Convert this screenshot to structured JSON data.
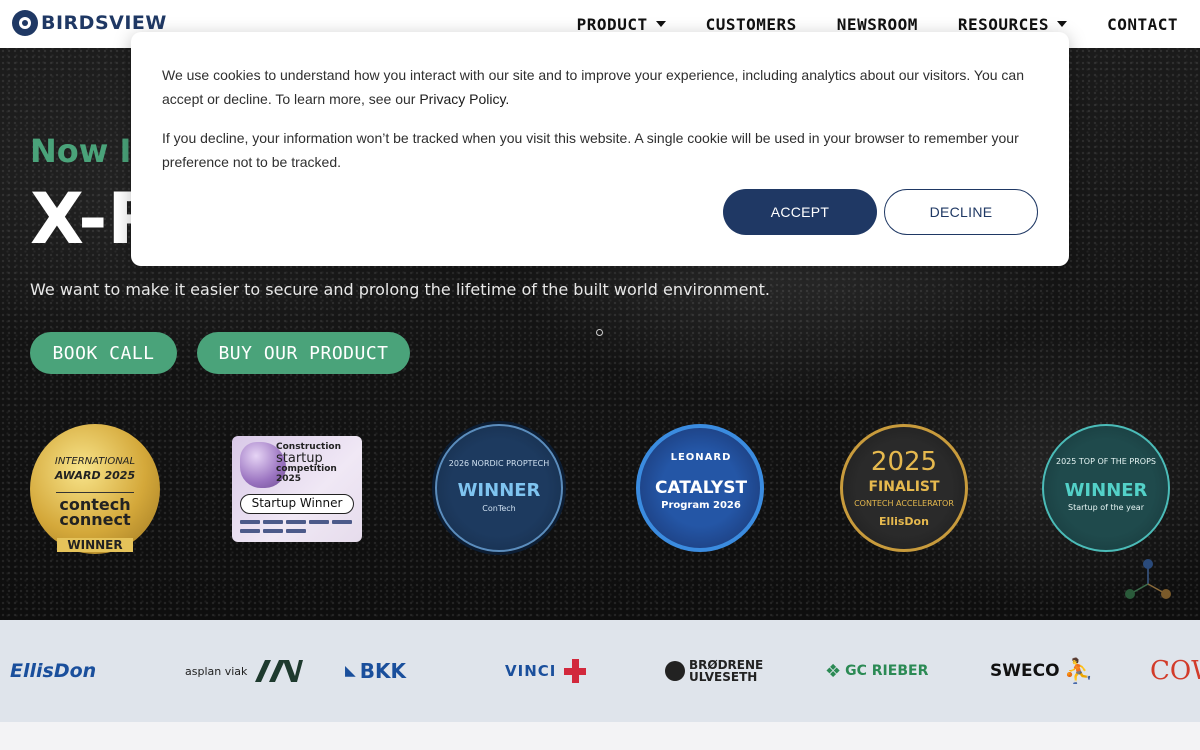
{
  "header": {
    "logo_text": "BIRDSVIEW",
    "nav": [
      {
        "label": "PRODUCT",
        "has_dropdown": true
      },
      {
        "label": "CUSTOMERS",
        "has_dropdown": false
      },
      {
        "label": "NEWSROOM",
        "has_dropdown": false
      },
      {
        "label": "RESOURCES",
        "has_dropdown": true
      },
      {
        "label": "CONTACT",
        "has_dropdown": false
      }
    ]
  },
  "hero": {
    "eyebrow": "Now In",
    "title": "X-R",
    "subtitle": "We want to make it easier to secure and prolong the lifetime of the built world environment.",
    "book_button": "BOOK CALL",
    "buy_button": "BUY OUR PRODUCT"
  },
  "badges": {
    "contech": {
      "line1": "INTERNATIONAL",
      "line2": "AWARD 2025",
      "brand": "contech connect",
      "ribbon": "WINNER"
    },
    "startup": {
      "line1": "Construction",
      "line2": "startup",
      "line3": "competition 2025",
      "pill": "Startup Winner"
    },
    "nordic": {
      "top": "2026 NORDIC PROPTECH",
      "main": "WINNER",
      "sub": "ConTech"
    },
    "leonard": {
      "brand": "LEONARD",
      "main": "CATALYST",
      "sub": "Program 2026"
    },
    "ellisdon": {
      "year": "2025",
      "main": "FINALIST",
      "sub": "CONTECH ACCELERATOR",
      "brand": "EllisDon"
    },
    "props": {
      "top": "2025 TOP OF THE PROPS",
      "main": "WINNER",
      "sub": "Startup of the year"
    }
  },
  "clients": [
    "EllisDon",
    "asplan viak",
    "BKK",
    "VINCI",
    "BRØDRENE ULVESETH",
    "GC RIEBER",
    "SWECO",
    "COW"
  ],
  "cookie": {
    "text1": "We use cookies to understand how you interact with our site and to improve your experience, including analytics about our visitors. You can accept or decline. To learn more, see our ",
    "privacy_link": "Privacy Policy.",
    "text2": "If you decline, your information won’t be tracked when you visit this website. A single cookie will be used in your browser to remember your preference not to be tracked.",
    "accept": "ACCEPT",
    "decline": "DECLINE"
  },
  "colors": {
    "brand_navy": "#1f3864",
    "accent_green": "#4aa37a"
  }
}
